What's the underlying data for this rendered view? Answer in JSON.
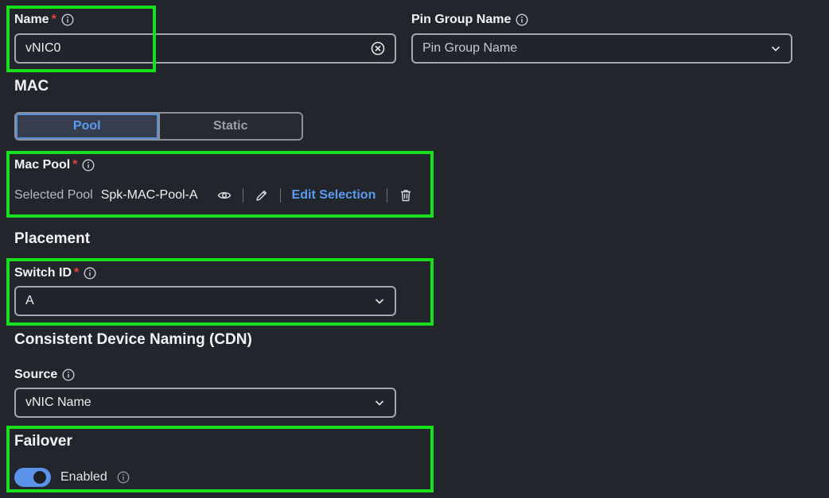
{
  "name_field": {
    "label": "Name",
    "required_mark": "*",
    "value": "vNIC0"
  },
  "pin_group": {
    "label": "Pin Group Name",
    "placeholder": "Pin Group Name"
  },
  "mac": {
    "title": "MAC",
    "options": [
      "Pool",
      "Static"
    ],
    "selected": "Pool"
  },
  "mac_pool": {
    "label": "Mac Pool",
    "required_mark": "*",
    "selected_label": "Selected Pool",
    "pool_name": "Spk-MAC-Pool-A",
    "edit_label": "Edit Selection"
  },
  "placement": {
    "title": "Placement"
  },
  "switch_id": {
    "label": "Switch ID",
    "required_mark": "*",
    "value": "A"
  },
  "cdn": {
    "title": "Consistent Device Naming (CDN)",
    "source_label": "Source",
    "source_value": "vNIC Name"
  },
  "failover": {
    "title": "Failover",
    "toggle_label": "Enabled",
    "enabled": true
  },
  "colors": {
    "background": "#22252c",
    "accent": "#5b9cf2",
    "highlight": "#16e01c",
    "required": "#e0443c"
  }
}
